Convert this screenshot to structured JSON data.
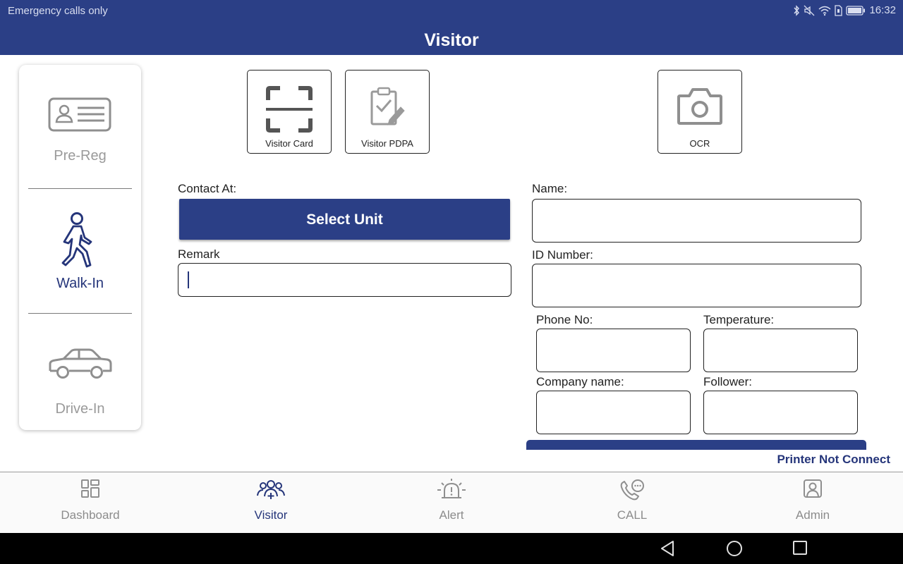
{
  "status_bar": {
    "carrier": "Emergency calls only",
    "time": "16:32"
  },
  "title": "Visitor",
  "modes": [
    {
      "label": "Pre-Reg",
      "icon": "id-card-icon",
      "active": false
    },
    {
      "label": "Walk-In",
      "icon": "walking-person-icon",
      "active": true
    },
    {
      "label": "Drive-In",
      "icon": "car-icon",
      "active": false
    }
  ],
  "actions": {
    "visitor_card": "Visitor Card",
    "visitor_pdpa": "Visitor PDPA",
    "ocr": "OCR"
  },
  "form": {
    "contact_at_label": "Contact At:",
    "select_unit": "Select Unit",
    "remark_label": "Remark",
    "remark_value": "",
    "name_label": "Name:",
    "id_label": "ID Number:",
    "phone_label": "Phone No:",
    "temperature_label": "Temperature:",
    "company_label": "Company name:",
    "follower_label": "Follower:"
  },
  "printer_status": "Printer Not Connect",
  "bottom_nav": [
    {
      "label": "Dashboard",
      "icon": "dashboard-icon",
      "active": false
    },
    {
      "label": "Visitor",
      "icon": "visitor-group-icon",
      "active": true
    },
    {
      "label": "Alert",
      "icon": "alarm-icon",
      "active": false
    },
    {
      "label": "CALL",
      "icon": "phone-call-icon",
      "active": false
    },
    {
      "label": "Admin",
      "icon": "admin-icon",
      "active": false
    }
  ],
  "colors": {
    "primary": "#2b3f86",
    "active_text": "#25357a",
    "inactive_text": "#8c8c8c"
  }
}
